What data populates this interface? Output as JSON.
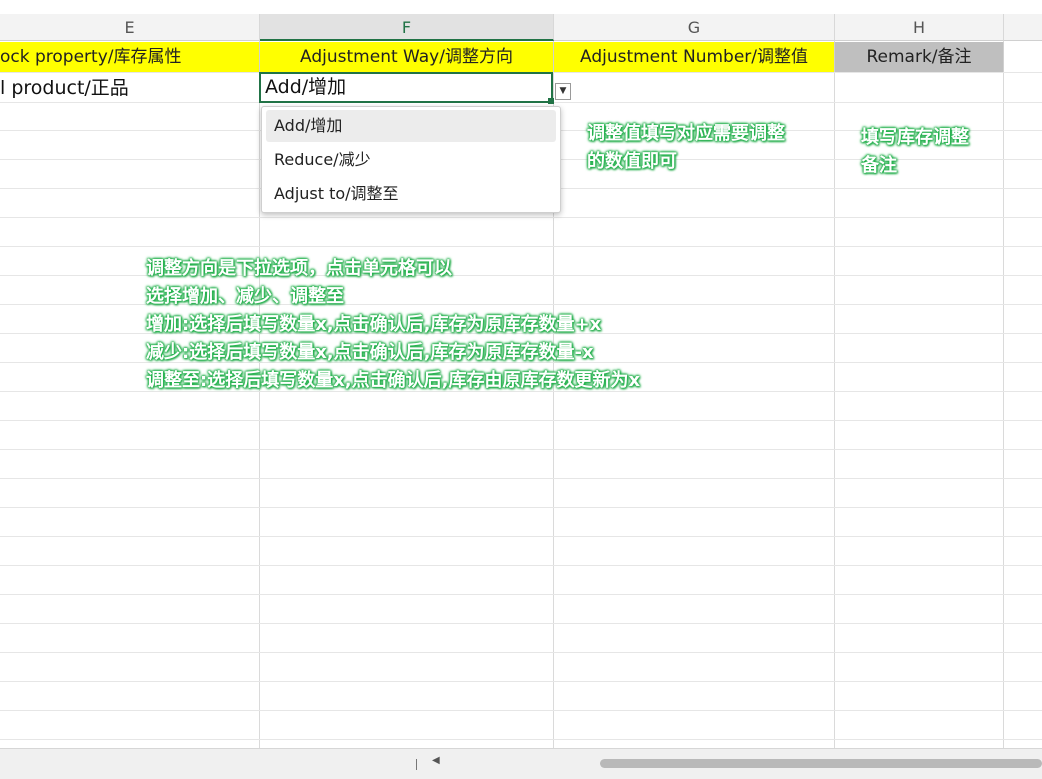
{
  "columns": [
    {
      "letter": "E",
      "active": false
    },
    {
      "letter": "F",
      "active": true
    },
    {
      "letter": "G",
      "active": false
    },
    {
      "letter": "H",
      "active": false
    }
  ],
  "header_row": {
    "e": "ock property/库存属性",
    "f": "Adjustment Way/调整方向",
    "g": "Adjustment Number/调整值",
    "h": "Remark/备注"
  },
  "row1": {
    "e": "l product/正品",
    "f": "Add/增加"
  },
  "dropdown": {
    "options": [
      "Add/增加",
      "Reduce/减少",
      "Adjust to/调整至"
    ],
    "highlighted_index": 0
  },
  "notes": {
    "number_note": [
      "调整值填写对应需要调整",
      "的数值即可"
    ],
    "remark_note": [
      "填写库存调整",
      "备注"
    ],
    "direction_note": [
      "调整方向是下拉选项，点击单元格可以",
      "选择增加、减少、调整至",
      "增加:选择后填写数量x,点击确认后,库存为原库存数量+x",
      "减少:选择后填写数量x,点击确认后,库存为原库存数量-x",
      "调整至:选择后填写数量x,点击确认后,库存由原库存数更新为x"
    ]
  },
  "colors": {
    "header_yellow": "#ffff00",
    "header_gray": "#bfbfbf",
    "active_border": "#217346",
    "note_green": "#22b14c"
  },
  "icons": {
    "dropdown_arrow": "chevron-down-icon",
    "scroll_left": "triangle-left-icon"
  }
}
